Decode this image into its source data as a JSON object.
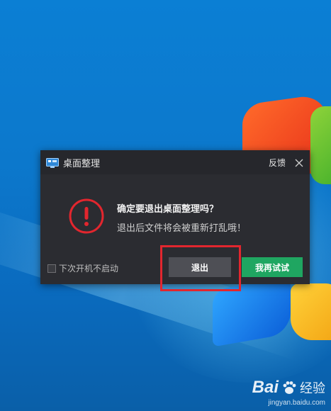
{
  "dialog": {
    "title": "桌面整理",
    "feedback_label": "反馈",
    "close_icon": "close-icon",
    "warning_icon": "exclamation-circle-icon",
    "message_title": "确定要退出桌面整理吗？",
    "message_sub": "退出后文件将会被重新打乱哦！",
    "checkbox_label": "下次开机不启动",
    "checkbox_checked": false,
    "exit_button": "退出",
    "retry_button": "我再试试"
  },
  "colors": {
    "dialog_bg": "#2b2c31",
    "warning_red": "#e2262e",
    "retry_green": "#1fa661",
    "exit_gray": "#4e4f55",
    "highlight_red": "#e2262e"
  },
  "watermark": {
    "brand": "Bai",
    "suffix": "经验",
    "url": "jingyan.baidu.com"
  }
}
